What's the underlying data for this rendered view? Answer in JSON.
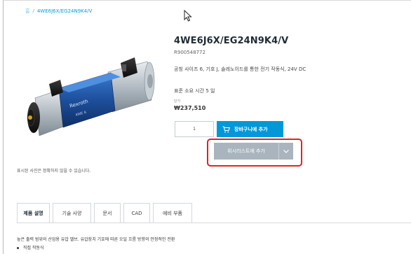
{
  "breadcrumb": {
    "home": "홈",
    "separator": "/",
    "current": "4WE6J6X/EG24N9K4/V"
  },
  "product": {
    "title": "4WE6J6X/EG24N9K4/V",
    "part_number": "R900548772",
    "description": "공칭 사이즈 6, 기호 J, 솔레노이드를 통한 전기 작동식, 24V DC",
    "lead_time": "표준 소요 시간 5 일",
    "price_label": "단가",
    "price": "₩237,510",
    "image_note": "표시된 사진은 정확하지 않을 수 있습니다."
  },
  "actions": {
    "quantity": "1",
    "add_to_cart": "장바구니에 추가",
    "add_to_wishlist": "위시리스트에 추가"
  },
  "tabs": [
    {
      "label": "제품 설명",
      "active": true
    },
    {
      "label": "기술 사양",
      "active": false
    },
    {
      "label": "문서",
      "active": false
    },
    {
      "label": "CAD",
      "active": false
    },
    {
      "label": "예비 부품",
      "active": false
    }
  ],
  "content": {
    "summary": "높은 출력 범위의 산업용 유압 밸브. 유압장치 기호에 따른 오일 흐름 방향의 안정적인 전환",
    "bullets": [
      "직접 작동식"
    ]
  },
  "colors": {
    "accent": "#0098d8",
    "highlight": "#e0241b",
    "wishlist_button": "#a9b4be"
  }
}
